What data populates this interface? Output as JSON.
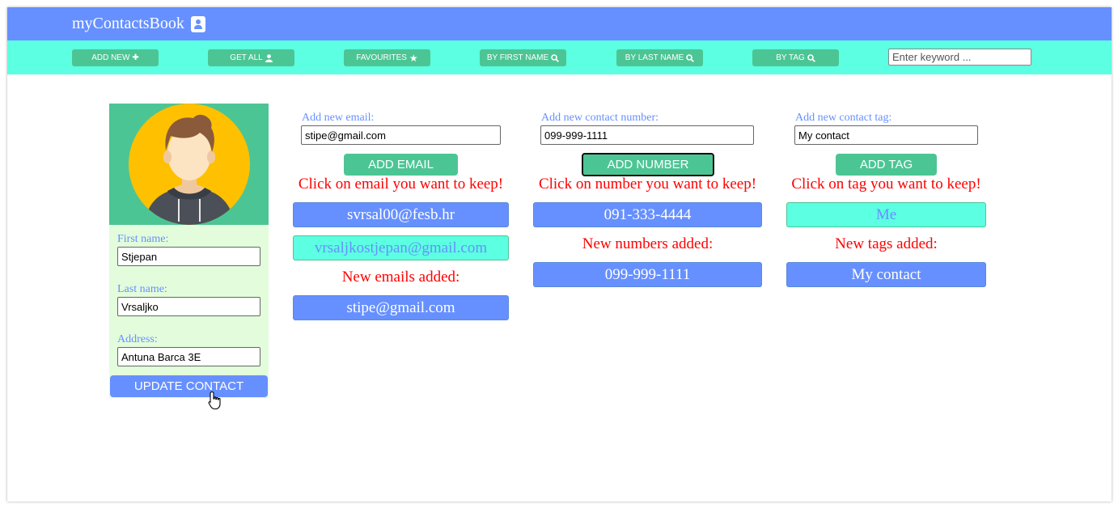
{
  "app": {
    "title": "myContactsBook",
    "icon": "address-book-icon"
  },
  "nav": {
    "buttons": [
      {
        "label": "ADD NEW",
        "icon": "plus-square-icon",
        "glyph": "✚"
      },
      {
        "label": "GET ALL",
        "icon": "user-icon",
        "glyph": "👤"
      },
      {
        "label": "FAVOURITES",
        "icon": "star-icon",
        "glyph": "★"
      },
      {
        "label": "BY FIRST NAME",
        "icon": "search-icon",
        "glyph": "🔍"
      },
      {
        "label": "BY LAST NAME",
        "icon": "search-icon",
        "glyph": "🔍"
      },
      {
        "label": "BY TAG",
        "icon": "search-icon",
        "glyph": "🔍"
      }
    ],
    "search_placeholder": "Enter keyword ..."
  },
  "contact": {
    "first_name_label": "First name:",
    "first_name": "Stjepan",
    "last_name_label": "Last name:",
    "last_name": "Vrsaljko",
    "address_label": "Address:",
    "address": "Antuna Barca 3E",
    "update_label": "UPDATE CONTACT"
  },
  "emails": {
    "label": "Add new email:",
    "input_value": "stipe@gmail.com",
    "add_label": "ADD EMAIL",
    "hint": "Click on email you want to keep!",
    "existing": [
      {
        "value": "svrsal00@fesb.hr",
        "selected": false
      },
      {
        "value": "vrsaljkostjepan@gmail.com",
        "selected": true
      }
    ],
    "added_label": "New emails added:",
    "added": [
      "stipe@gmail.com"
    ]
  },
  "numbers": {
    "label": "Add new contact number:",
    "input_value": "099-999-1111",
    "add_label": "ADD NUMBER",
    "hint": "Click on number you want to keep!",
    "existing": [
      {
        "value": "091-333-4444",
        "selected": false
      }
    ],
    "added_label": "New numbers added:",
    "added": [
      "099-999-1111"
    ]
  },
  "tags": {
    "label": "Add new contact tag:",
    "input_value": "My contact",
    "add_label": "ADD TAG",
    "hint": "Click on tag you want to keep!",
    "existing": [
      {
        "value": "Me",
        "selected": true
      }
    ],
    "added_label": "New tags added:",
    "added": [
      "My contact"
    ]
  },
  "colors": {
    "topbar": "#6690ff",
    "navbar": "#5cffe1",
    "green_button": "#4cc594",
    "hint_red": "#ff0000",
    "card_bg": "#e3fddc"
  }
}
